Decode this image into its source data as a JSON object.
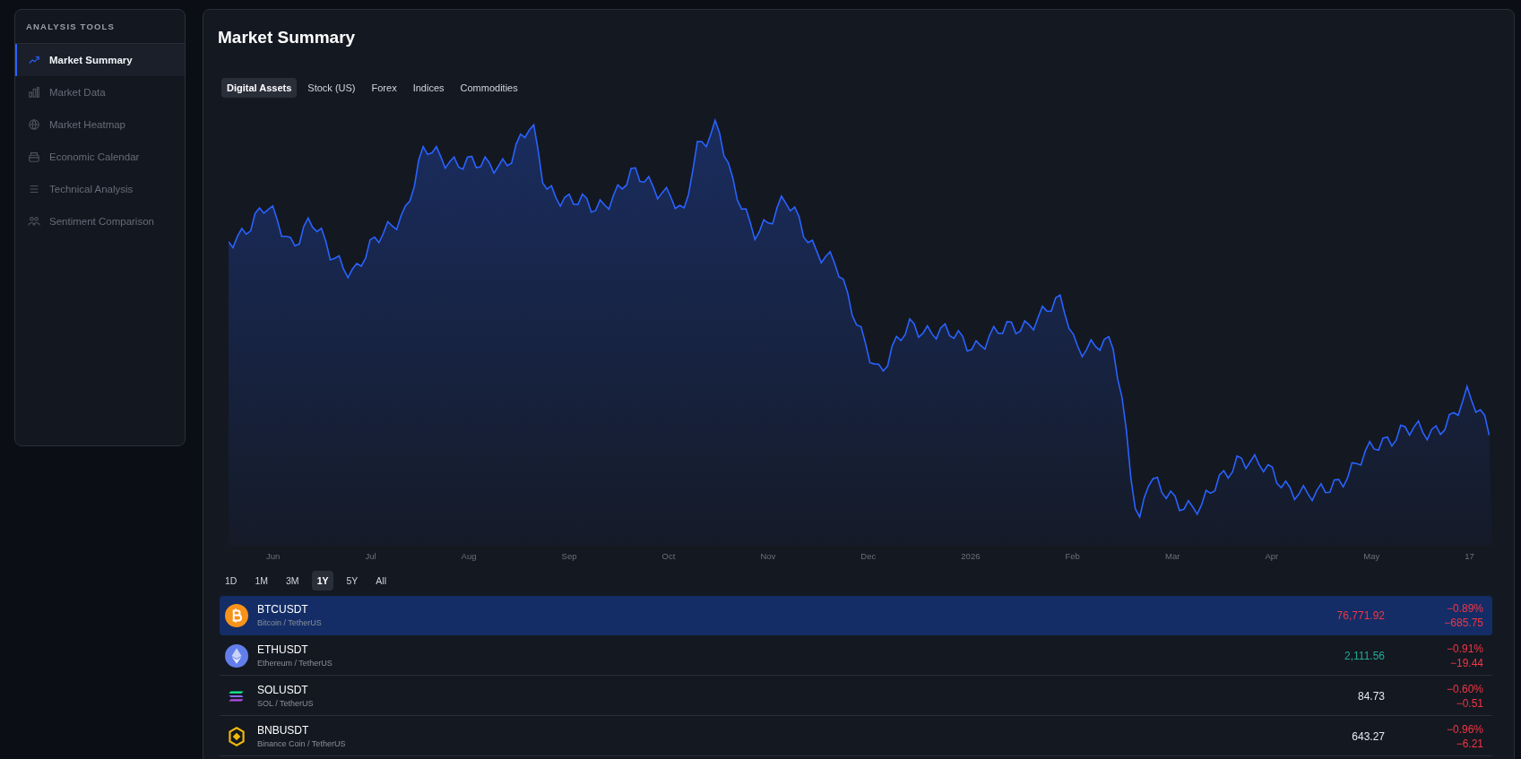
{
  "sidebar": {
    "heading": "ANALYSIS TOOLS",
    "items": [
      {
        "label": "Market Summary",
        "selected": true
      },
      {
        "label": "Market Data",
        "selected": false
      },
      {
        "label": "Market Heatmap",
        "selected": false
      },
      {
        "label": "Economic Calendar",
        "selected": false
      },
      {
        "label": "Technical Analysis",
        "selected": false
      },
      {
        "label": "Sentiment Comparison",
        "selected": false
      }
    ]
  },
  "main": {
    "title": "Market Summary",
    "tabs": [
      {
        "label": "Digital Assets",
        "selected": true
      },
      {
        "label": "Stock (US)",
        "selected": false
      },
      {
        "label": "Forex",
        "selected": false
      },
      {
        "label": "Indices",
        "selected": false
      },
      {
        "label": "Commodities",
        "selected": false
      }
    ],
    "x_axis_labels": [
      "Jun",
      "Jul",
      "Aug",
      "Sep",
      "Oct",
      "Nov",
      "Dec",
      "2026",
      "Feb",
      "Mar",
      "Apr",
      "May",
      "17"
    ],
    "ranges": [
      {
        "label": "1D",
        "selected": false
      },
      {
        "label": "1M",
        "selected": false
      },
      {
        "label": "3M",
        "selected": false
      },
      {
        "label": "1Y",
        "selected": true
      },
      {
        "label": "5Y",
        "selected": false
      },
      {
        "label": "All",
        "selected": false
      }
    ],
    "rows": [
      {
        "symbol": "BTCUSDT",
        "name": "Bitcoin / TetherUS",
        "price": {
          "value": "76,771.92",
          "color": "#f23645"
        },
        "change": {
          "percent": "−0.89%",
          "amount": "−685.75",
          "color": "#f23645"
        },
        "selected": true
      },
      {
        "symbol": "ETHUSDT",
        "name": "Ethereum / TetherUS",
        "price": {
          "value": "2,111.56",
          "color": "#22ab94"
        },
        "change": {
          "percent": "−0.91%",
          "amount": "−19.44",
          "color": "#f23645"
        },
        "selected": false
      },
      {
        "symbol": "SOLUSDT",
        "name": "SOL / TetherUS",
        "price": {
          "value": "84.73",
          "color": "#e6e9ef"
        },
        "change": {
          "percent": "−0.60%",
          "amount": "−0.51",
          "color": "#f23645"
        },
        "selected": false
      },
      {
        "symbol": "BNBUSDT",
        "name": "Binance Coin / TetherUS",
        "price": {
          "value": "643.27",
          "color": "#e6e9ef"
        },
        "change": {
          "percent": "−0.96%",
          "amount": "−6.21",
          "color": "#f23645"
        },
        "selected": false
      }
    ]
  }
}
